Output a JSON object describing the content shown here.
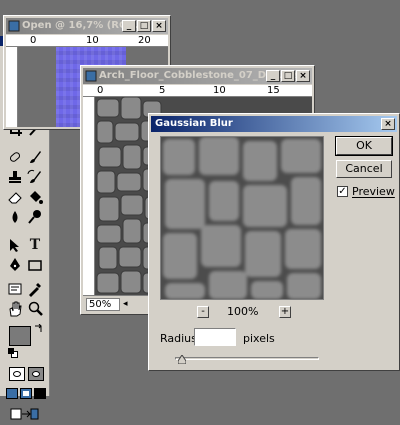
{
  "window_open": {
    "title": "Open @ 16,7% (RG...",
    "ruler_labels": [
      "0",
      "10",
      "20"
    ]
  },
  "window_doc": {
    "title": "Arch_Floor_Cobblestone_07_Diffuse...",
    "ruler_labels": [
      "0",
      "5",
      "10",
      "15"
    ],
    "zoom_status": "50%"
  },
  "dialog": {
    "title": "Gaussian Blur",
    "ok_label": "OK",
    "cancel_label": "Cancel",
    "preview_label": "Preview",
    "preview_checked": true,
    "zoom_out": "-",
    "zoom_in": "+",
    "zoom_level": "100%",
    "radius_label": "Radius:",
    "radius_value": "",
    "radius_unit": "pixels",
    "slider_fraction": 0.05
  },
  "toolbox": {
    "foreground_color": "#7a7a7a",
    "background_color": "#ffffff"
  },
  "colors": {
    "active_title": "#0a246a",
    "workspace": "#6f6f6f",
    "open_canvas": "#6f68e8"
  }
}
